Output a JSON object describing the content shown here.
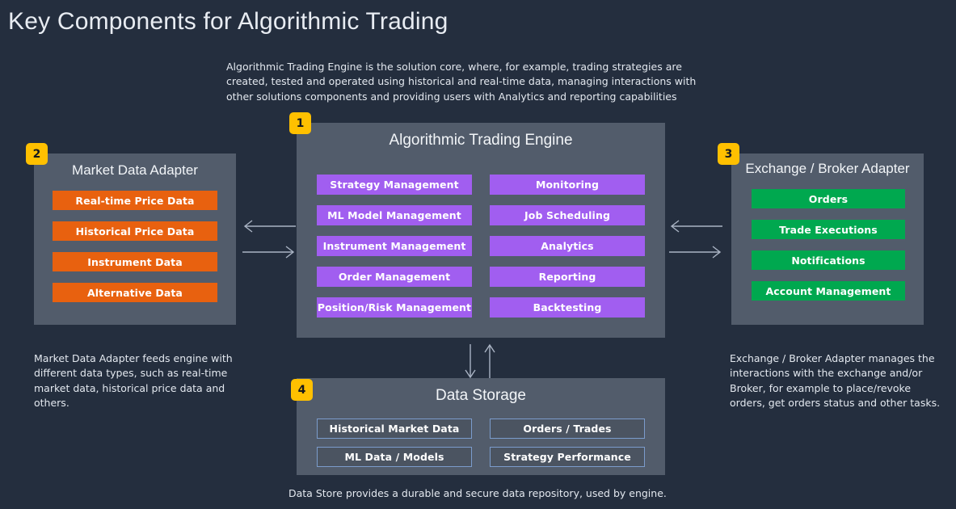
{
  "title": "Key Components for Algorithmic Trading",
  "descriptions": {
    "engine": "Algorithmic Trading Engine is the solution core, where, for example, trading strategies are created, tested and operated using historical and real-time data, managing interactions with other solutions components and providing users with Analytics and reporting capabilities",
    "market_adapter": "Market Data Adapter feeds engine with different data types, such as real-time market data, historical price data and others.",
    "exchange_adapter": "Exchange / Broker Adapter manages the interactions with the exchange and/or Broker, for example to place/revoke orders, get orders status and other tasks.",
    "data_storage": "Data Store provides a durable and secure data repository, used by engine."
  },
  "badges": {
    "engine": "1",
    "market_adapter": "2",
    "exchange_adapter": "3",
    "data_storage": "4"
  },
  "panels": {
    "engine": {
      "title": "Algorithmic Trading Engine",
      "accent": "#a15ef0",
      "items": [
        "Strategy Management",
        "Monitoring",
        "ML Model Management",
        "Job Scheduling",
        "Instrument Management",
        "Analytics",
        "Order Management",
        "Reporting",
        "Position/Risk Management",
        "Backtesting"
      ]
    },
    "market_adapter": {
      "title": "Market Data Adapter",
      "accent": "#e8610f",
      "items": [
        "Real-time Price Data",
        "Historical Price Data",
        "Instrument Data",
        "Alternative Data"
      ]
    },
    "exchange_adapter": {
      "title": "Exchange / Broker Adapter",
      "accent": "#00a84f",
      "items": [
        "Orders",
        "Trade Executions",
        "Notifications",
        "Account Management"
      ]
    },
    "data_storage": {
      "title": "Data Storage",
      "accent": "#4b5461",
      "items": [
        "Historical Market Data",
        "Orders / Trades",
        "ML Data / Models",
        "Strategy Performance"
      ]
    }
  },
  "colors": {
    "background": "#242e3e",
    "panel": "#525c6b",
    "badge": "#ffc000",
    "arrow": "#aab4c4",
    "text": "#e8ecf2"
  },
  "arrows": {
    "left_pair": "bidirectional-horizontal",
    "right_pair": "bidirectional-horizontal",
    "bottom_pair": "bidirectional-vertical"
  }
}
